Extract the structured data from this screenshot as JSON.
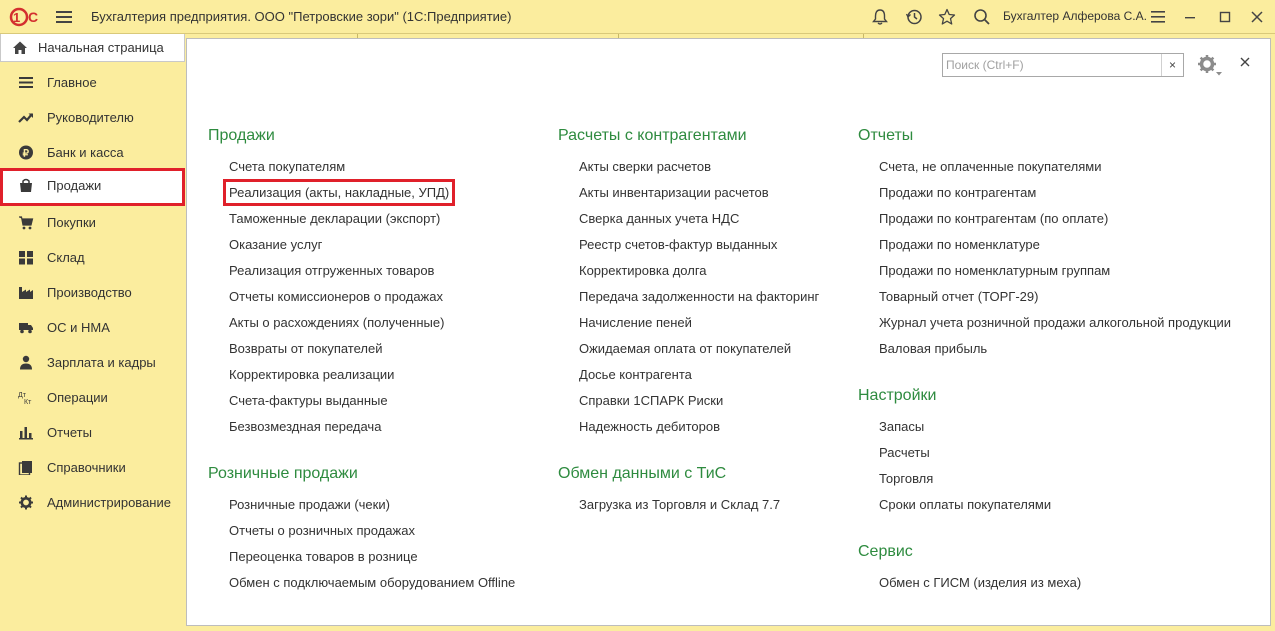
{
  "app": {
    "title": "Бухгалтерия предприятия. ООО \"Петровские зори\"  (1С:Предприятие)",
    "user": "Бухгалтер Алферова С.А."
  },
  "home_tab": {
    "label": "Начальная страница",
    "icon": "home-icon"
  },
  "sidebar": {
    "active_index": 3,
    "items": [
      {
        "label": "Главное",
        "icon": "menu-lines-icon"
      },
      {
        "label": "Руководителю",
        "icon": "trend-up-icon"
      },
      {
        "label": "Банк и касса",
        "icon": "ruble-coin-icon"
      },
      {
        "label": "Продажи",
        "icon": "shopping-bag-icon"
      },
      {
        "label": "Покупки",
        "icon": "cart-icon"
      },
      {
        "label": "Склад",
        "icon": "warehouse-grid-icon"
      },
      {
        "label": "Производство",
        "icon": "factory-icon"
      },
      {
        "label": "ОС и НМА",
        "icon": "truck-icon"
      },
      {
        "label": "Зарплата и кадры",
        "icon": "person-icon"
      },
      {
        "label": "Операции",
        "icon": "dt-kt-icon"
      },
      {
        "label": "Отчеты",
        "icon": "bar-chart-icon"
      },
      {
        "label": "Справочники",
        "icon": "book-icon"
      },
      {
        "label": "Администрирование",
        "icon": "gear-icon"
      }
    ]
  },
  "search": {
    "placeholder": "Поиск (Ctrl+F)",
    "clear": "×"
  },
  "colors": {
    "section_title": "#2e8b3f",
    "highlight": "#e0202a",
    "panel_bg": "#fbed9e"
  },
  "sections": {
    "sales": {
      "title": "Продажи",
      "links": [
        "Счета покупателям",
        "Реализация (акты, накладные, УПД)",
        "Таможенные декларации (экспорт)",
        "Оказание услуг",
        "Реализация отгруженных товаров",
        "Отчеты комиссионеров о продажах",
        "Акты о расхождениях (полученные)",
        "Возвраты от покупателей",
        "Корректировка реализации",
        "Счета-фактуры выданные",
        "Безвозмездная передача"
      ]
    },
    "retail": {
      "title": "Розничные продажи",
      "links": [
        "Розничные продажи (чеки)",
        "Отчеты о розничных продажах",
        "Переоценка товаров в рознице",
        "Обмен с подключаемым оборудованием Offline"
      ]
    },
    "settlements": {
      "title": "Расчеты с контрагентами",
      "links": [
        "Акты сверки расчетов",
        "Акты инвентаризации расчетов",
        "Сверка данных учета НДС",
        "Реестр счетов-фактур выданных",
        "Корректировка долга",
        "Передача задолженности на факторинг",
        "Начисление пеней",
        "Ожидаемая оплата от покупателей",
        "Досье контрагента",
        "Справки 1СПАРК Риски",
        "Надежность дебиторов"
      ]
    },
    "exchange": {
      "title": "Обмен данными с ТиС",
      "links": [
        "Загрузка из Торговля и Склад 7.7"
      ]
    },
    "reports": {
      "title": "Отчеты",
      "links": [
        "Счета, не оплаченные покупателями",
        "Продажи по контрагентам",
        "Продажи по контрагентам (по оплате)",
        "Продажи по номенклатуре",
        "Продажи по номенклатурным группам",
        "Товарный отчет (ТОРГ-29)",
        "Журнал учета розничной продажи алкогольной продукции",
        "Валовая прибыль"
      ]
    },
    "settings": {
      "title": "Настройки",
      "links": [
        "Запасы",
        "Расчеты",
        "Торговля",
        "Сроки оплаты покупателями"
      ]
    },
    "service": {
      "title": "Сервис",
      "links": [
        "Обмен с ГИСМ (изделия из меха)"
      ]
    }
  },
  "highlighted_link": "Реализация (акты, накладные, УПД)"
}
